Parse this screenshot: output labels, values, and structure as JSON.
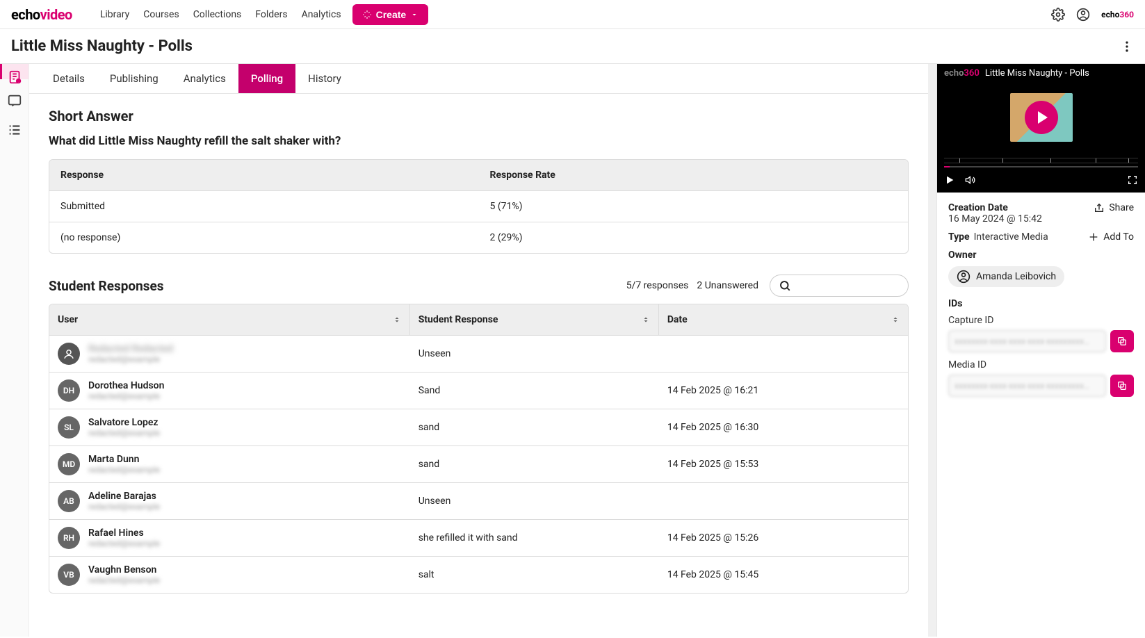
{
  "logo": {
    "part1": "echo",
    "part2": "video"
  },
  "nav": {
    "links": [
      "Library",
      "Courses",
      "Collections",
      "Folders",
      "Analytics"
    ],
    "create": "Create"
  },
  "brand360": {
    "part1": "echo",
    "part2": "360"
  },
  "page_title": "Little Miss Naughty - Polls",
  "tabs": [
    "Details",
    "Publishing",
    "Analytics",
    "Polling",
    "History"
  ],
  "active_tab": "Polling",
  "poll": {
    "type_title": "Short Answer",
    "question": "What did Little Miss Naughty refill the salt shaker with?",
    "headers": [
      "Response",
      "Response Rate"
    ],
    "rows": [
      {
        "label": "Submitted",
        "rate": "5 (71%)"
      },
      {
        "label": "(no response)",
        "rate": "2 (29%)"
      }
    ]
  },
  "student": {
    "title": "Student Responses",
    "stats_responses": "5/7 responses",
    "stats_unanswered": "2 Unanswered",
    "columns": [
      "User",
      "Student Response",
      "Date"
    ],
    "rows": [
      {
        "initials": "",
        "anon": true,
        "name": "",
        "email": "",
        "response": "Unseen",
        "date": ""
      },
      {
        "initials": "DH",
        "name": "Dorothea Hudson",
        "email": "redacted@example",
        "response": "Sand",
        "date": "14 Feb 2025 @ 16:21"
      },
      {
        "initials": "SL",
        "name": "Salvatore Lopez",
        "email": "redacted@example",
        "response": "sand",
        "date": "14 Feb 2025 @ 16:30"
      },
      {
        "initials": "MD",
        "name": "Marta Dunn",
        "email": "redacted@example",
        "response": "sand",
        "date": "14 Feb 2025 @ 15:53"
      },
      {
        "initials": "AB",
        "name": "Adeline Barajas",
        "email": "redacted@example",
        "response": "Unseen",
        "date": ""
      },
      {
        "initials": "RH",
        "name": "Rafael Hines",
        "email": "redacted@example",
        "response": "she refilled it with sand",
        "date": "14 Feb 2025 @ 15:26"
      },
      {
        "initials": "VB",
        "name": "Vaughn Benson",
        "email": "redacted@example",
        "response": "salt",
        "date": "14 Feb 2025 @ 15:45"
      }
    ]
  },
  "side_panel": {
    "video_title": "Little Miss Naughty - Polls",
    "creation_label": "Creation Date",
    "creation_value": "16 May 2024 @ 15:42",
    "share": "Share",
    "type_label": "Type",
    "type_value": "Interactive Media",
    "add_to": "Add To",
    "owner_label": "Owner",
    "owner_name": "Amanda Leibovich",
    "ids_label": "IDs",
    "capture_label": "Capture ID",
    "capture_value": "xxxxxxxx-xxxx-xxxx-xxxx-xxxxxxxxx…",
    "media_label": "Media ID",
    "media_value": "xxxxxxxx-xxxx-xxxx-xxxx-xxxxxxxxx…"
  }
}
